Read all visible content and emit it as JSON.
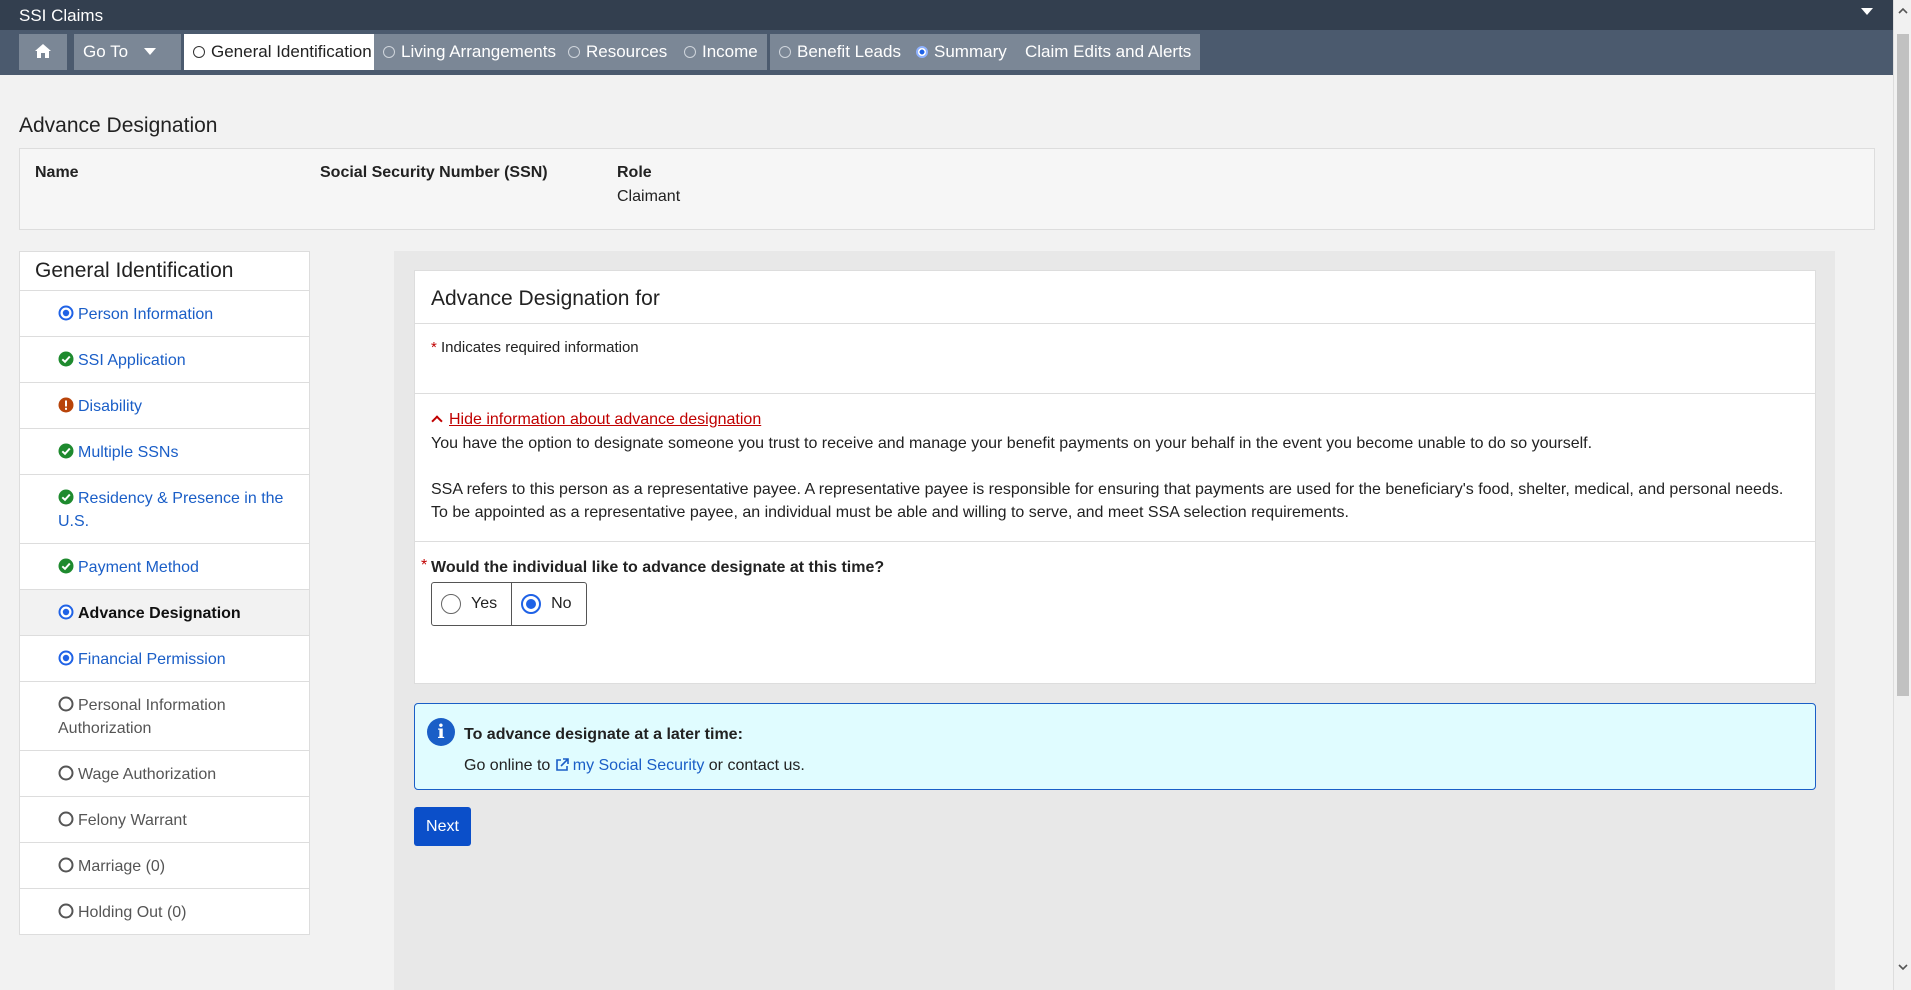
{
  "app": {
    "title": "SSI Claims"
  },
  "nav": {
    "goto_label": "Go To",
    "tabs": [
      {
        "label": "General Identification",
        "state": "active"
      },
      {
        "label": "Living Arrangements",
        "state": "empty"
      },
      {
        "label": "Resources",
        "state": "none"
      },
      {
        "label": "Income",
        "state": "empty"
      },
      {
        "label": "Benefit Leads",
        "state": "empty"
      },
      {
        "label": "Summary",
        "state": "selected"
      },
      {
        "label": "Claim Edits and Alerts",
        "state": "none"
      }
    ]
  },
  "page": {
    "title": "Advance Designation"
  },
  "person": {
    "name_header": "Name",
    "ssn_header": "Social Security Number (SSN)",
    "role_header": "Role",
    "role_value": "Claimant"
  },
  "sidebar": {
    "title": "General Identification",
    "items": [
      {
        "label": "Person Information",
        "status": "in-progress"
      },
      {
        "label": "SSI Application",
        "status": "complete"
      },
      {
        "label": "Disability",
        "status": "error"
      },
      {
        "label": "Multiple SSNs",
        "status": "complete"
      },
      {
        "label": "Residency & Presence in the U.S.",
        "status": "complete"
      },
      {
        "label": "Payment Method",
        "status": "complete"
      },
      {
        "label": "Advance Designation",
        "status": "current"
      },
      {
        "label": "Financial Permission",
        "status": "in-progress"
      },
      {
        "label": "Personal Information Authorization",
        "status": "not-started"
      },
      {
        "label": "Wage Authorization",
        "status": "not-started"
      },
      {
        "label": "Felony Warrant",
        "status": "not-started"
      },
      {
        "label": "Marriage (0)",
        "status": "not-started"
      },
      {
        "label": "Holding Out (0)",
        "status": "not-started"
      }
    ]
  },
  "card": {
    "title": "Advance Designation for",
    "required_note": "Indicates required information",
    "toggle_link": "Hide information about advance designation",
    "para1": "You have the option to designate someone you trust to receive and manage your benefit payments on your behalf in the event you become unable to do so yourself.",
    "para2": "SSA refers to this person as a representative payee. A representative payee is responsible for ensuring that payments are used for the beneficiary's food, shelter, medical, and personal needs. To be appointed as a representative payee, an individual must be able and willing to serve, and meet SSA selection requirements.",
    "question": "Would the individual like to advance designate at this time?",
    "options": {
      "yes": "Yes",
      "no": "No"
    },
    "selected": "No"
  },
  "info": {
    "title": "To advance designate at a later time:",
    "pre": "Go online to ",
    "link": "my Social Security",
    "post": " or contact us."
  },
  "next_label": "Next",
  "colors": {
    "link": "#1a5ec7",
    "complete": "#1e8a2e",
    "error": "#b8440a",
    "in_progress": "#1f62e6",
    "required": "#c00000",
    "header": "#333f4f"
  }
}
